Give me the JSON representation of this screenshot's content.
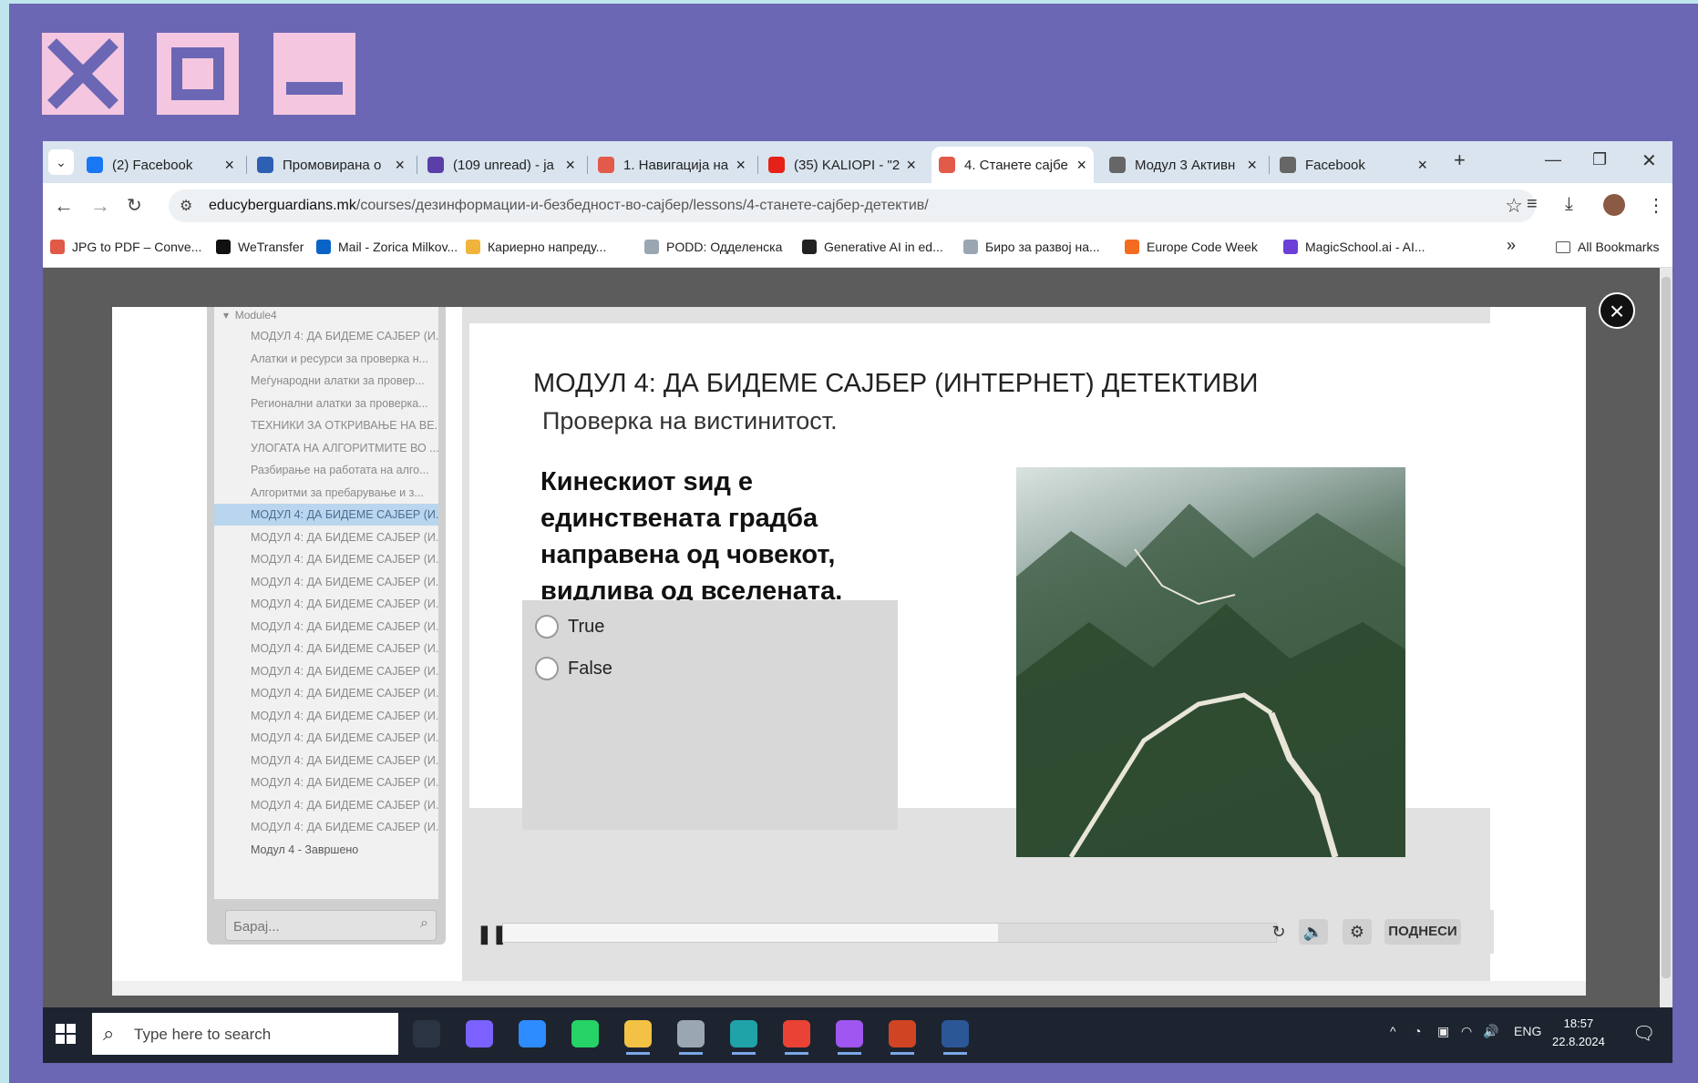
{
  "decor": {
    "icons": [
      "close-icon",
      "maximize-icon",
      "minimize-icon"
    ],
    "bg": "#6b67b4",
    "accent": "#f5c6e0"
  },
  "browser": {
    "tabs": [
      {
        "title": "(2) Facebook",
        "color": "#1877f2",
        "active": false
      },
      {
        "title": "Промовирана о",
        "color": "#2d5fb3",
        "active": false
      },
      {
        "title": "(109 unread) - ja",
        "color": "#5b3fa8",
        "active": false
      },
      {
        "title": "1. Навигација на",
        "color": "#e25b4a",
        "active": false
      },
      {
        "title": "(35) KALIOPI - \"2",
        "color": "#e62117",
        "active": false
      },
      {
        "title": "4. Станете сајбе",
        "color": "#e25b4a",
        "active": true
      },
      {
        "title": "Модул 3 Активн",
        "color": "#666666",
        "active": false
      },
      {
        "title": "Facebook",
        "color": "#666666",
        "active": false
      }
    ],
    "new_tab": "+",
    "window_controls": {
      "minimize": "—",
      "restore": "❐",
      "close": "✕"
    },
    "url_domain": "educyberguardians.mk",
    "url_path": "/courses/дезинформации-и-безбедност-во-сајбер/lessons/4-станете-сајбер-детектив/",
    "bookmarks": [
      {
        "label": "JPG to PDF – Conve...",
        "color": "#e05a47"
      },
      {
        "label": "WeTransfer",
        "color": "#111111"
      },
      {
        "label": "Mail - Zorica Milkov...",
        "color": "#0a64c8"
      },
      {
        "label": "Кариерно напреду...",
        "color": "#f0b33c"
      },
      {
        "label": "PODD: Одделенска",
        "color": "#9aa6b2"
      },
      {
        "label": "Generative AI in ed...",
        "color": "#222222"
      },
      {
        "label": "Биро за развој на...",
        "color": "#9aa6b2"
      },
      {
        "label": "Europe Code Week",
        "color": "#f36b21"
      },
      {
        "label": "MagicSchool.ai - AI...",
        "color": "#6c3fd6"
      }
    ],
    "more_bookmarks": "»",
    "all_bookmarks": "All Bookmarks"
  },
  "outline": {
    "module": "Module4",
    "items": [
      "МОДУЛ 4: ДА БИДЕМЕ САЈБЕР (И...",
      "Алатки и ресурси за проверка н...",
      "Меѓународни алатки за провер...",
      "Регионални алатки за проверка...",
      "ТЕХНИКИ ЗА ОТКРИВАЊЕ НА ВЕ...",
      "УЛОГАТА НА АЛГОРИТМИТЕ ВО ...",
      "Разбирање на работата на алго...",
      "Алгоритми за пребарување и з...",
      "МОДУЛ 4: ДА БИДЕМЕ САЈБЕР (И...",
      "МОДУЛ 4: ДА БИДЕМЕ САЈБЕР (И...",
      "МОДУЛ 4: ДА БИДЕМЕ САЈБЕР (И...",
      "МОДУЛ 4: ДА БИДЕМЕ САЈБЕР (И...",
      "МОДУЛ 4: ДА БИДЕМЕ САЈБЕР (И...",
      "МОДУЛ 4: ДА БИДЕМЕ САЈБЕР (И...",
      "МОДУЛ 4: ДА БИДЕМЕ САЈБЕР (И...",
      "МОДУЛ 4: ДА БИДЕМЕ САЈБЕР (И...",
      "МОДУЛ 4: ДА БИДЕМЕ САЈБЕР (И...",
      "МОДУЛ 4: ДА БИДЕМЕ САЈБЕР (И...",
      "МОДУЛ 4: ДА БИДЕМЕ САЈБЕР (И...",
      "МОДУЛ 4: ДА БИДЕМЕ САЈБЕР (И...",
      "МОДУЛ 4: ДА БИДЕМЕ САЈБЕР (И...",
      "МОДУЛ 4: ДА БИДЕМЕ САЈБЕР (И...",
      "МОДУЛ 4: ДА БИДЕМЕ САЈБЕР (И...",
      "Модул 4 - Завршено"
    ],
    "selected_index": 8,
    "search_placeholder": "Барај..."
  },
  "slide": {
    "title": "МОДУЛ 4: ДА БИДЕМЕ САЈБЕР (ИНТЕРНЕТ) ДЕТЕКТИВИ",
    "subtitle": "Проверка на вистинитост.",
    "question": "Кинескиот ѕид е единствената градба направена од човекот, видлива од вселената.",
    "options": [
      "True",
      "False"
    ]
  },
  "player": {
    "progress": 0.64,
    "submit_label": "ПОДНЕСИ"
  },
  "taskbar": {
    "search_placeholder": "Type here to search",
    "apps": [
      {
        "name": "task-view",
        "color": "#2b3442"
      },
      {
        "name": "copilot",
        "color": "#7b61ff"
      },
      {
        "name": "zoom",
        "color": "#2d8cff"
      },
      {
        "name": "whatsapp",
        "color": "#25d366"
      },
      {
        "name": "file-explorer",
        "color": "#f3c244"
      },
      {
        "name": "microphone",
        "color": "#9aa6b2"
      },
      {
        "name": "edge",
        "color": "#1fa2a8"
      },
      {
        "name": "chrome",
        "color": "#ea4335"
      },
      {
        "name": "messenger",
        "color": "#a056f0"
      },
      {
        "name": "powerpoint",
        "color": "#d04423"
      },
      {
        "name": "word",
        "color": "#2b5797"
      }
    ],
    "language": "ENG",
    "time": "18:57",
    "date": "22.8.2024"
  }
}
